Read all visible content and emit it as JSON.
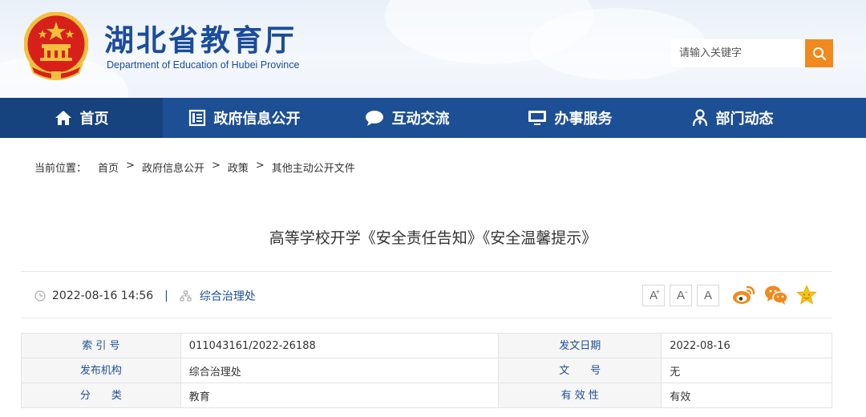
{
  "header": {
    "title": "湖北省教育厅",
    "subtitle": "Department of Education of Hubei Province",
    "search_placeholder": "请输入关键字"
  },
  "nav": {
    "items": [
      {
        "label": "首页",
        "icon": "home-icon"
      },
      {
        "label": "政府信息公开",
        "icon": "document-list-icon"
      },
      {
        "label": "互动交流",
        "icon": "chat-bubble-icon"
      },
      {
        "label": "办事服务",
        "icon": "monitor-icon"
      },
      {
        "label": "部门动态",
        "icon": "person-icon"
      }
    ]
  },
  "breadcrumb": {
    "label": "当前位置：",
    "items": [
      "首页",
      "政府信息公开",
      "政策",
      "其他主动公开文件"
    ],
    "separator": ">"
  },
  "article": {
    "title": "高等学校开学《安全责任告知》《安全温馨提示》",
    "datetime": "2022-08-16 14:56",
    "separator": "|",
    "department": "综合治理处"
  },
  "font_controls": {
    "increase": "A",
    "increase_sup": "+",
    "decrease": "A",
    "decrease_sup": "-",
    "reset": "A"
  },
  "share": {
    "icons": [
      "weibo-icon",
      "wechat-icon",
      "favorite-star-icon"
    ]
  },
  "info_table": {
    "rows": [
      {
        "k1": "索 引 号",
        "v1": "011043161/2022-26188",
        "k2": "发文日期",
        "v2": "2022-08-16"
      },
      {
        "k1": "发布机构",
        "v1": "综合治理处",
        "k2": "文　　号",
        "v2": "无"
      },
      {
        "k1": "分　　类",
        "v1": "教育",
        "k2": "有 效 性",
        "v2": "有效"
      }
    ]
  },
  "colors": {
    "brand_blue": "#1d4f95",
    "nav_active": "#16427e",
    "search_orange": "#f08a1e",
    "emblem_red": "#d7201a",
    "emblem_gold": "#f3c03d"
  }
}
